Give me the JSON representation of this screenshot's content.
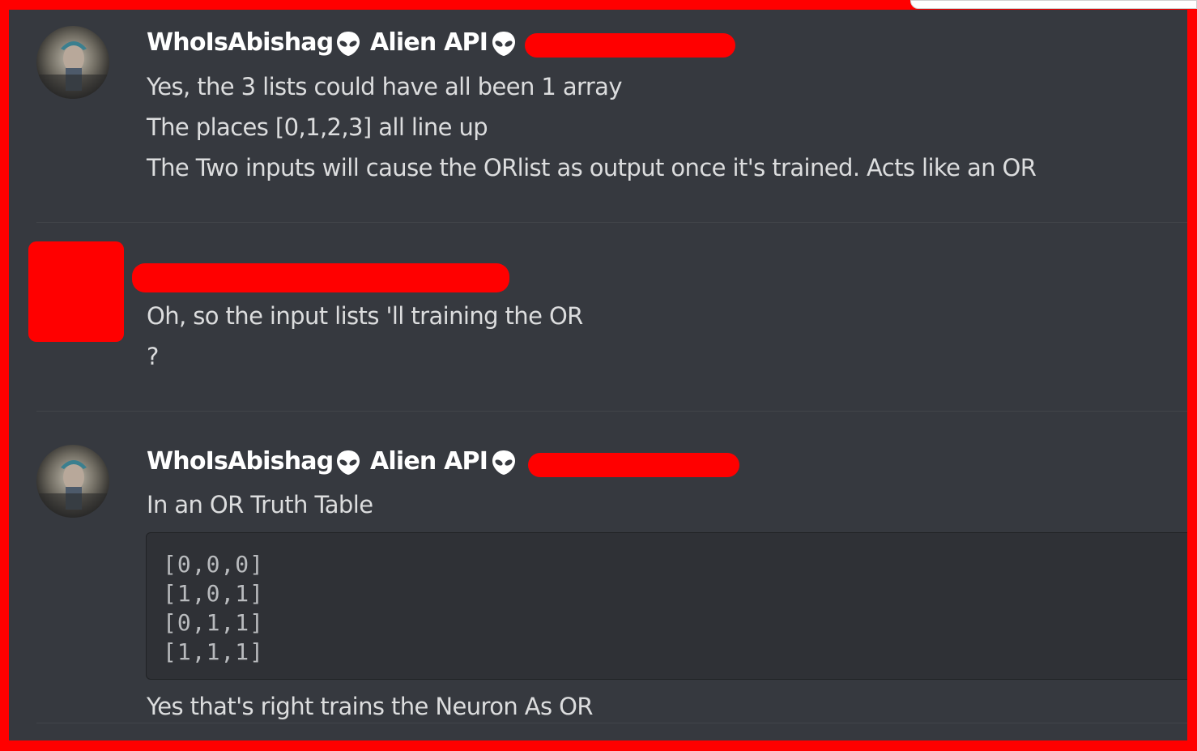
{
  "messages": [
    {
      "username": "WhoIsAbishag",
      "bot_tag": "Alien API",
      "lines": [
        "Yes, the 3 lists could have all been 1 array",
        "The places [0,1,2,3] all line up",
        "The Two inputs will cause the ORlist as output once it's trained. Acts like an OR"
      ]
    },
    {
      "username": "",
      "lines": [
        "Oh, so the input lists 'll training the OR",
        "?"
      ]
    },
    {
      "username": "WhoIsAbishag",
      "bot_tag": "Alien API",
      "lines": [
        "In an OR Truth Table"
      ],
      "code_lines": [
        "[0,0,0]",
        "[1,0,1]",
        "[0,1,1]",
        "[1,1,1]"
      ],
      "after_code": "Yes that's right trains the Neuron As OR"
    }
  ],
  "colors": {
    "background": "#36393f",
    "redaction": "#ff0000",
    "text": "#dcddde",
    "username": "#ffffff",
    "code_bg": "#2f3136",
    "code_text": "#b9bbbe"
  },
  "icons": [
    "alien-icon",
    "avatar"
  ]
}
